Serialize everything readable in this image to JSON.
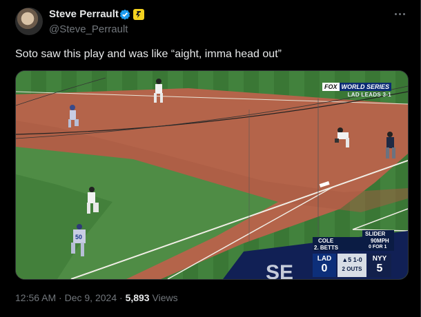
{
  "author": {
    "name": "Steve Perrault",
    "handle": "@Steve_Perrault",
    "verified_icon": "verified-badge-icon",
    "affiliation_icon": "affiliation-badge-icon"
  },
  "tweet": {
    "text": "Soto saw this play and was like “aight, imma head out”"
  },
  "broadcast": {
    "network": "FOX",
    "event": "WORLD SERIES",
    "series_status": "LAD LEADS 3-1",
    "pitch_type": "SLIDER",
    "pitch_speed": "90MPH",
    "pitch_count": "0 FOR 1",
    "pitcher": "COLE",
    "batter": "2. BETTS",
    "away_team": "LAD",
    "away_score": "0",
    "home_team": "NYY",
    "home_score": "5",
    "inning": "▲5",
    "count": "1-0",
    "outs": "2 OUTS",
    "jersey_number": "50",
    "wall_text": "SE"
  },
  "meta": {
    "time": "12:56 AM",
    "separator": "·",
    "date": "Dec 9, 2024",
    "views_count": "5,893",
    "views_label": "Views"
  },
  "colors": {
    "background": "#000000",
    "text": "#e7e9ea",
    "muted": "#71767b",
    "verified": "#1d9bf0",
    "affiliation": "#f4d21f"
  }
}
